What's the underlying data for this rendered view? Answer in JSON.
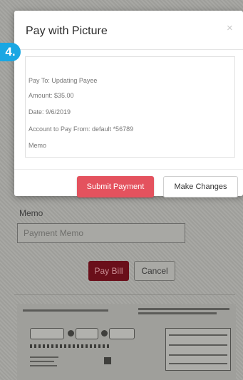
{
  "step_badge": "4.",
  "modal": {
    "title": "Pay with Picture",
    "close_glyph": "×",
    "summary": {
      "pay_to": "Pay To: Updating Payee",
      "amount": "Amount: $35.00",
      "date": "Date: 9/6/2019",
      "account": "Account to Pay From: default *56789",
      "memo": "Memo"
    },
    "buttons": {
      "submit": "Submit Payment",
      "changes": "Make Changes"
    }
  },
  "background_form": {
    "memo_label": "Memo",
    "memo_placeholder": "Payment Memo",
    "pay_bill": "Pay Bill",
    "cancel": "Cancel"
  },
  "colors": {
    "accent_red": "#e4525e",
    "step_blue": "#1aa7e3"
  }
}
